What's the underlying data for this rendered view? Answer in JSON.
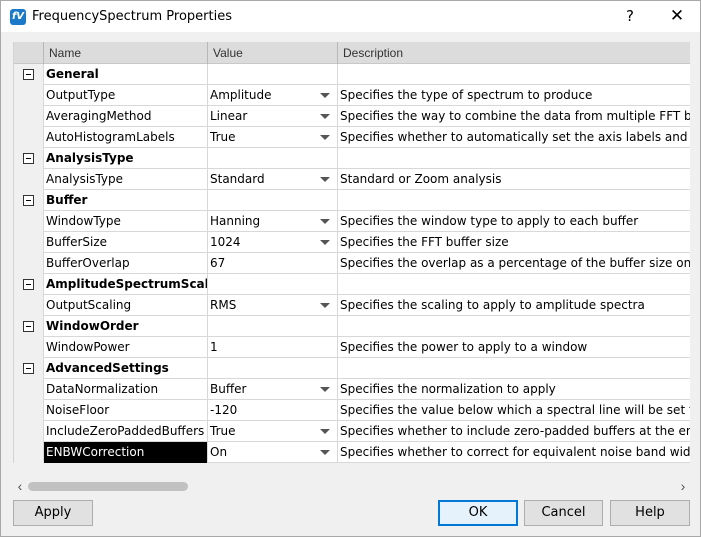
{
  "window": {
    "title": "FrequencySpectrum Properties",
    "logo_text": "fV",
    "help_glyph": "?",
    "close_glyph": "✕"
  },
  "grid": {
    "columns": {
      "name": "Name",
      "value": "Value",
      "description": "Description"
    },
    "rows": [
      {
        "type": "category",
        "name": "General",
        "value": "",
        "desc": ""
      },
      {
        "type": "prop",
        "name": "OutputType",
        "value": "Amplitude",
        "desc": "Specifies the type of spectrum to produce",
        "dropdown": true
      },
      {
        "type": "prop",
        "name": "AveragingMethod",
        "value": "Linear",
        "desc": "Specifies the way to combine the data from multiple FFT buffers",
        "dropdown": true
      },
      {
        "type": "prop",
        "name": "AutoHistogramLabels",
        "value": "True",
        "desc": "Specifies whether to automatically set the axis labels and units f",
        "dropdown": true
      },
      {
        "type": "category",
        "name": "AnalysisType",
        "value": "",
        "desc": ""
      },
      {
        "type": "prop",
        "name": "AnalysisType",
        "value": "Standard",
        "desc": "Standard or Zoom analysis",
        "dropdown": true
      },
      {
        "type": "category",
        "name": "Buffer",
        "value": "",
        "desc": ""
      },
      {
        "type": "prop",
        "name": "WindowType",
        "value": "Hanning",
        "desc": "Specifies the window type to apply to each buffer",
        "dropdown": true
      },
      {
        "type": "prop",
        "name": "BufferSize",
        "value": "1024",
        "desc": "Specifies the FFT buffer size",
        "dropdown": true
      },
      {
        "type": "prop",
        "name": "BufferOverlap",
        "value": "67",
        "desc": "Specifies the overlap as a percentage of the buffer size on the i",
        "dropdown": false
      },
      {
        "type": "category",
        "name": "AmplitudeSpectrumScaling",
        "value": "",
        "desc": ""
      },
      {
        "type": "prop",
        "name": "OutputScaling",
        "value": "RMS",
        "desc": "Specifies the scaling to apply to amplitude spectra",
        "dropdown": true
      },
      {
        "type": "category",
        "name": "WindowOrder",
        "value": "",
        "desc": ""
      },
      {
        "type": "prop",
        "name": "WindowPower",
        "value": "1",
        "desc": "Specifies the power to apply to a window",
        "dropdown": false
      },
      {
        "type": "category",
        "name": "AdvancedSettings",
        "value": "",
        "desc": ""
      },
      {
        "type": "prop",
        "name": "DataNormalization",
        "value": "Buffer",
        "desc": "Specifies the normalization to apply",
        "dropdown": true
      },
      {
        "type": "prop",
        "name": "NoiseFloor",
        "value": "-120",
        "desc": "Specifies the value below which a spectral line will be set to zero",
        "dropdown": false
      },
      {
        "type": "prop",
        "name": "IncludeZeroPaddedBuffers",
        "value": "True",
        "desc": "Specifies whether to include zero-padded buffers at the end of t",
        "dropdown": true
      },
      {
        "type": "prop",
        "name": "ENBWCorrection",
        "value": "On",
        "desc": "Specifies whether to correct for equivalent noise band width",
        "dropdown": true,
        "selected": true
      }
    ]
  },
  "scrollbar": {
    "left_glyph": "‹",
    "right_glyph": "›"
  },
  "buttons": {
    "apply": "Apply",
    "ok": "OK",
    "cancel": "Cancel",
    "help": "Help"
  }
}
